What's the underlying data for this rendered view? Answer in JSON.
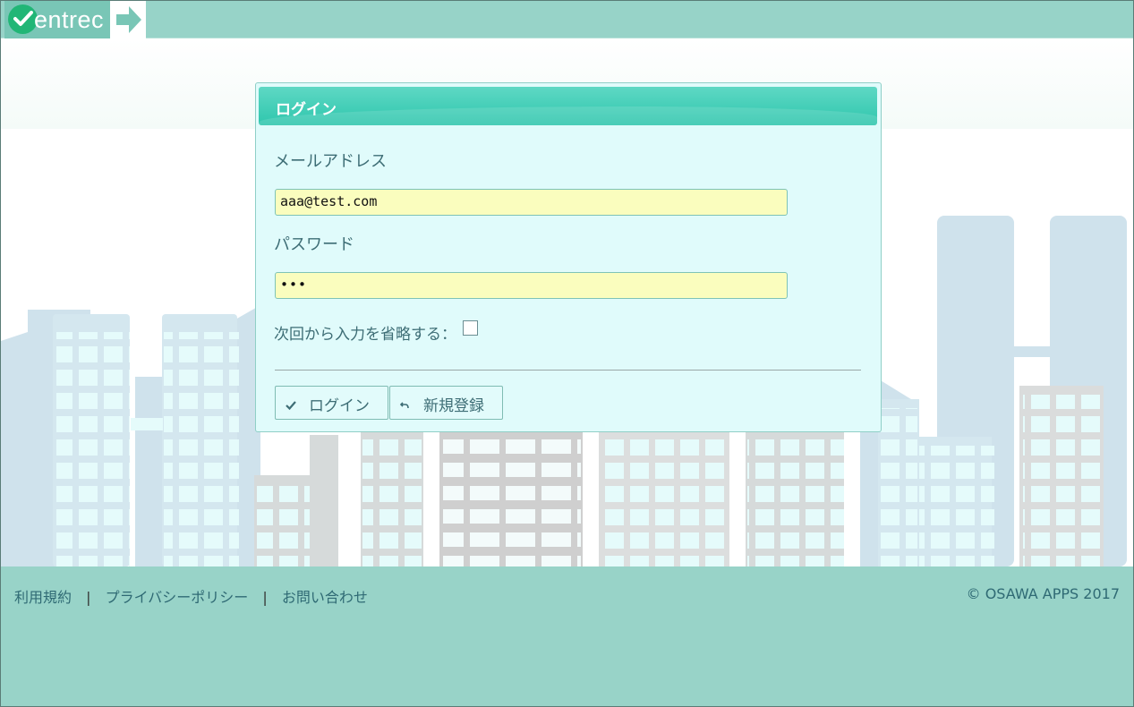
{
  "header": {
    "logo_text": "entrec"
  },
  "login": {
    "title": "ログイン",
    "email_label": "メールアドレス",
    "email_value": "aaa@test.com",
    "password_label": "パスワード",
    "password_value": "•••",
    "remember_label": "次回から入力を省略する：",
    "remember_checked": false,
    "login_button": "ログイン",
    "register_button": "新規登録"
  },
  "footer": {
    "links": [
      "利用規約",
      "プライバシーポリシー",
      "お問い合わせ"
    ],
    "separator": "|",
    "copyright": "© OSAWA APPS 2017"
  },
  "colors": {
    "header": "#97d3c8",
    "panel_header": "#2fc6ad",
    "input_bg": "#fafdbe",
    "footer": "#98d3c8"
  },
  "icons": {
    "logo": "checkmark-circle-icon",
    "logo_arrow": "arrow-right-icon",
    "login_button": "check-icon",
    "register_button": "return-arrow-icon"
  }
}
